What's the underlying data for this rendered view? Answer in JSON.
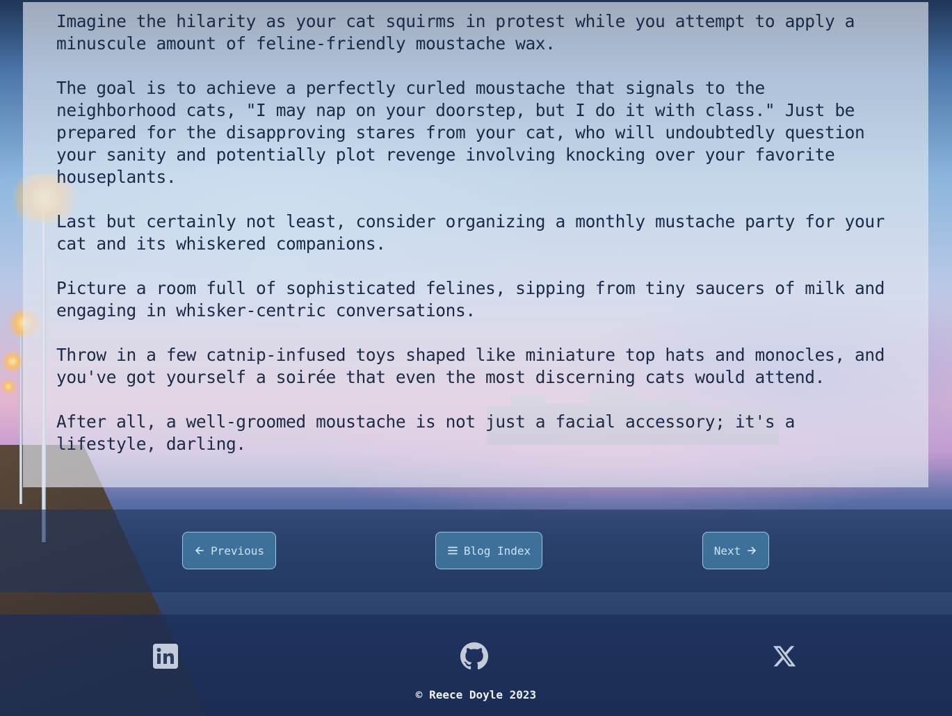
{
  "article": {
    "paragraphs": [
      "Imagine the hilarity as your cat squirms in protest while you attempt to apply a\nminuscule amount of feline-friendly moustache wax.",
      "The goal is to achieve a perfectly curled moustache that signals to the\nneighborhood cats, \"I may nap on your doorstep, but I do it with class.\" Just be\nprepared for the disapproving stares from your cat, who will undoubtedly question\nyour sanity and potentially plot revenge involving knocking over your favorite\nhouseplants.",
      "Last but certainly not least, consider organizing a monthly mustache party for your\ncat and its whiskered companions.",
      "Picture a room full of sophisticated felines, sipping from tiny saucers of milk and\nengaging in whisker-centric conversations.",
      "Throw in a few catnip-infused toys shaped like miniature top hats and monocles, and\nyou've got yourself a soirée that even the most discerning cats would attend.",
      "After all, a well-groomed moustache is not just a facial accessory; it's a\nlifestyle, darling."
    ]
  },
  "nav": {
    "previous_label": "Previous",
    "previous_icon": "arrow-left-icon",
    "index_label": "Blog Index",
    "index_icon": "menu-icon",
    "next_label": "Next",
    "next_icon": "arrow-right-icon"
  },
  "footer": {
    "social": [
      {
        "name": "linkedin-icon"
      },
      {
        "name": "github-icon"
      },
      {
        "name": "x-icon"
      }
    ],
    "copyright": "© Reece Doyle 2023"
  },
  "colors": {
    "text": "#1a2a48",
    "button_bg": "#4682aa",
    "button_text": "#c9e3f2",
    "icon": "#c4ccd8"
  }
}
